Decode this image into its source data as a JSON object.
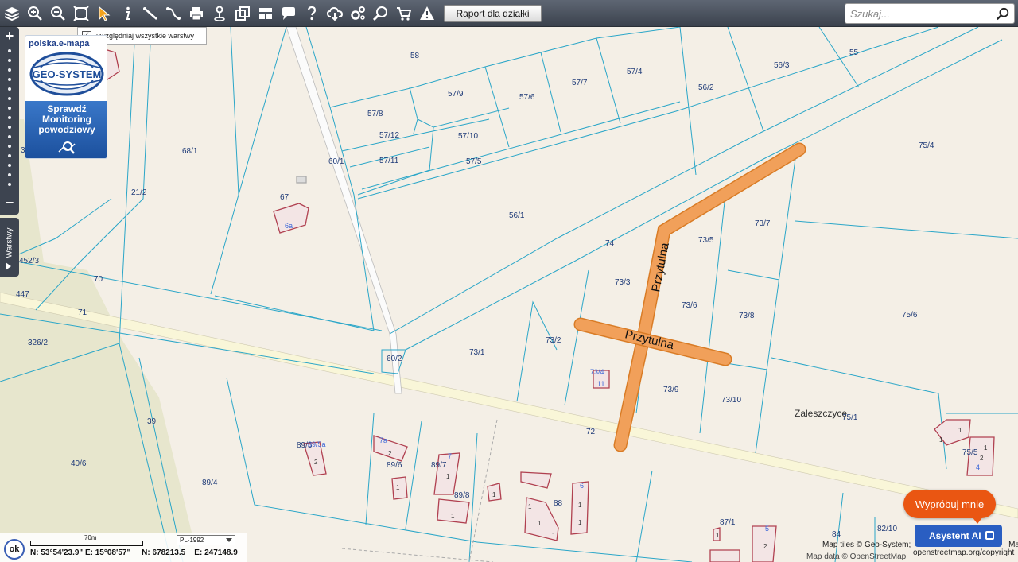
{
  "toolbar": {
    "report_label": "Raport dla działki",
    "icons": [
      "layers-icon",
      "zoom-in-icon",
      "zoom-out-icon",
      "full-extent-icon",
      "pointer-icon",
      "info-icon",
      "measure-distance-icon",
      "measure-area-icon",
      "print-icon",
      "location-pin-icon",
      "copy-icon",
      "layout-icon",
      "comment-icon",
      "help-icon",
      "cloud-download-icon",
      "settings-icon",
      "search-parcel-icon",
      "cart-icon",
      "warning-icon"
    ]
  },
  "search": {
    "placeholder": "Szukaj..."
  },
  "layers_panel": {
    "checkbox_label": "uwzględniaj wszystkie warstwy",
    "checked": true,
    "tab_label": "Warstwy"
  },
  "banner": {
    "site": "polska.e-mapa",
    "logo_text": "GEO-SYSTEM",
    "line1": "Sprawdź",
    "line2": "Monitoring",
    "line3": "powodziowy"
  },
  "map": {
    "street_name": "Przytulna",
    "place_name": "Zaleszczyce",
    "parcels": [
      "58",
      "55",
      "56/3",
      "57/4",
      "57/7",
      "57/9",
      "57/6",
      "56/2",
      "57/8",
      "57/12",
      "57/10",
      "57/11",
      "57/5",
      "60/1",
      "68/1",
      "75/4",
      "21/2",
      "67",
      "56/1",
      "73/7",
      "73/5",
      "74",
      "452/3",
      "73/3",
      "70",
      "447",
      "73/6",
      "73/8",
      "75/6",
      "71",
      "326/2",
      "73/1",
      "73/2",
      "60/2",
      "73/9",
      "73/10",
      "75/1",
      "39",
      "72",
      "89/5",
      "89/6",
      "89/7",
      "75/5",
      "40/6",
      "89/4",
      "89/8",
      "88",
      "87/1",
      "84",
      "82/10",
      "3"
    ],
    "building_numbers": [
      "1",
      "2",
      "4",
      "6",
      "7",
      "5"
    ],
    "building_labels": [
      "6a",
      "7a",
      "73/4",
      "89/5a",
      "11",
      "1"
    ]
  },
  "scale": {
    "label": "70m",
    "crs": "PL-1992"
  },
  "coordinates": {
    "lat": "N: 53°54'23.9\"",
    "lon": "E: 15°08'57\"",
    "n": "N: 678213.5",
    "e": "E: 247148.9"
  },
  "ok_label": "ok",
  "attribution": {
    "tiles": "Map tiles © Geo-System;",
    "tiles_tail": "Map",
    "data": "Map data © OpenStreetMap",
    "osm_link": "openstreetmap.org/copyright"
  },
  "assistant": {
    "bubble": "Wypróbuj mnie",
    "button": "Asystent AI"
  }
}
